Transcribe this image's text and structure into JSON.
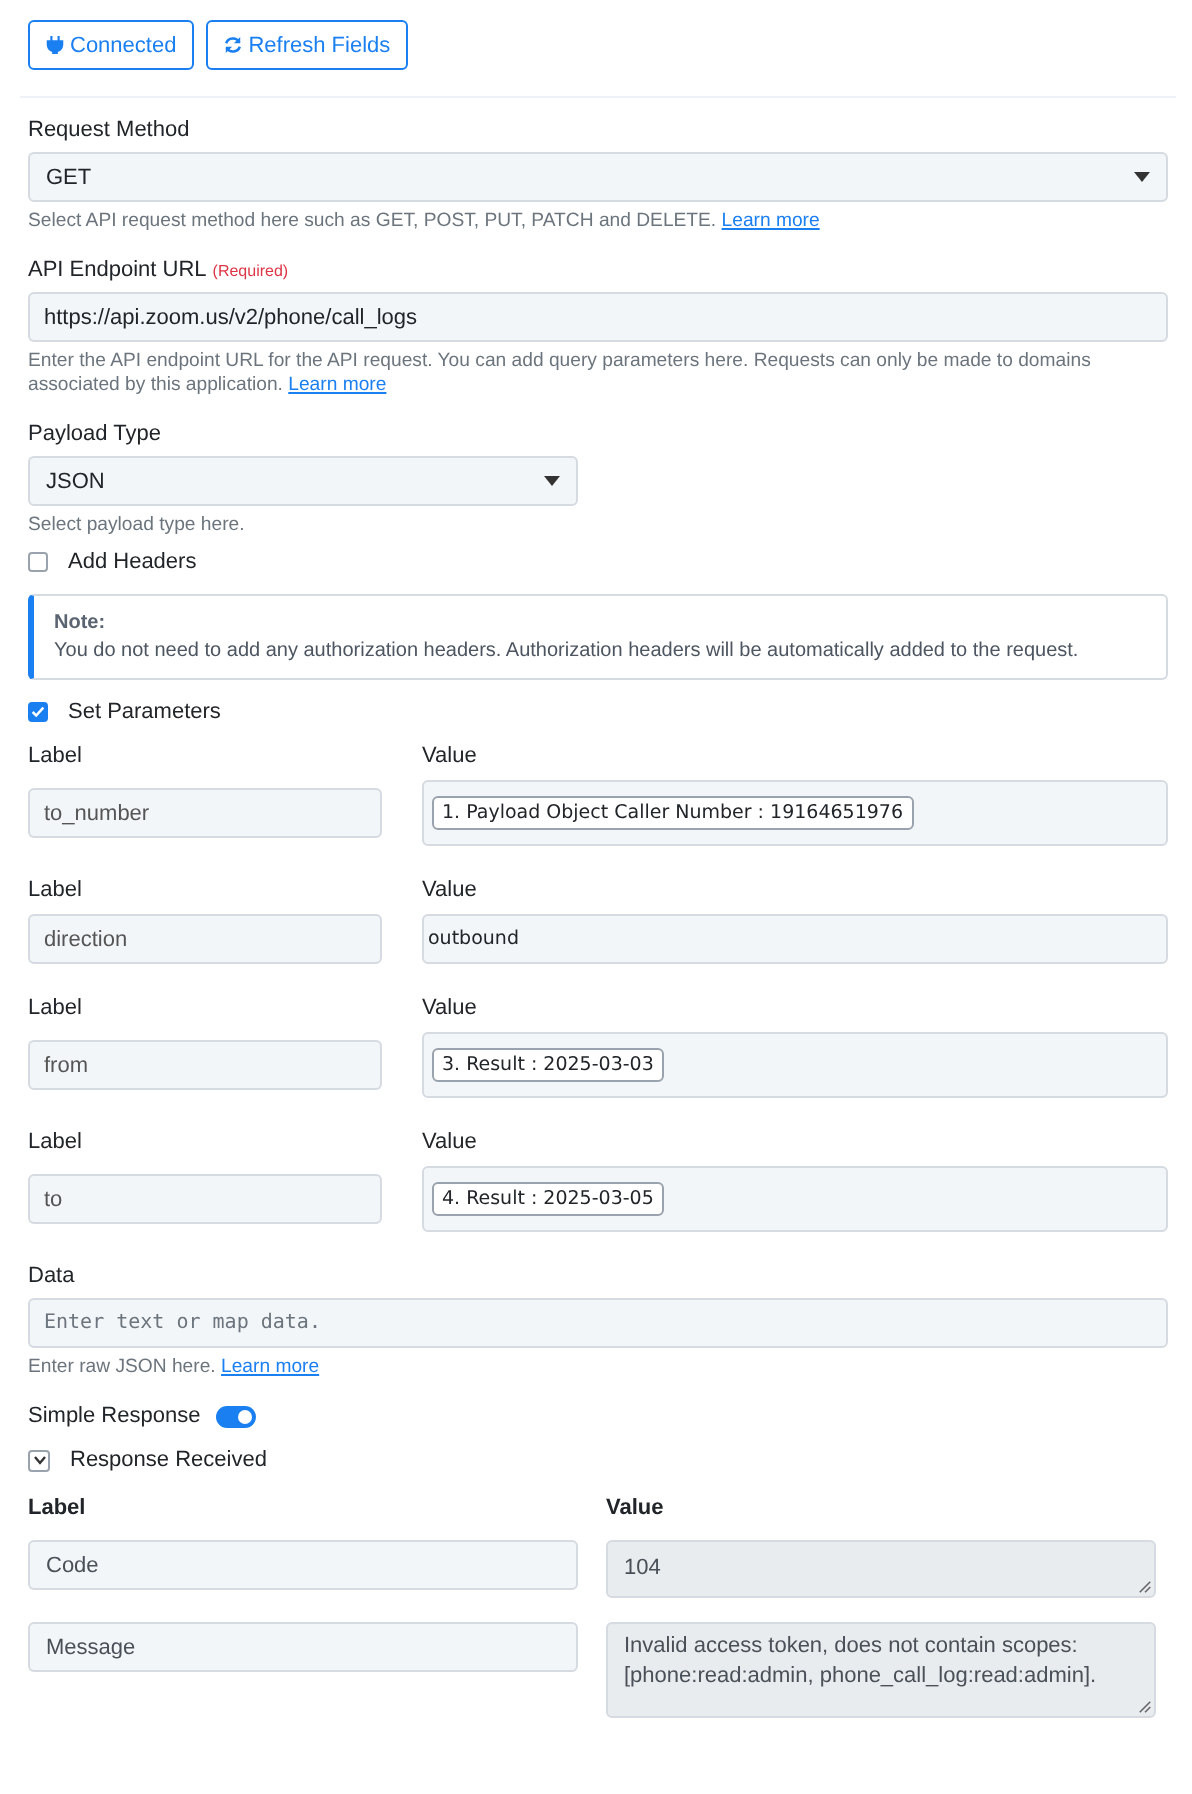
{
  "toolbar": [
    {
      "label": "Connected",
      "kind": "connection"
    },
    {
      "label": "Refresh Fields",
      "kind": "refresh"
    }
  ],
  "request_method": {
    "label": "Request Method",
    "value": "GET",
    "help": "Select API request method here such as GET, POST, PUT, PATCH and DELETE.",
    "help_link": "Learn more"
  },
  "endpoint": {
    "label": "API Endpoint URL",
    "required": "(Required)",
    "value": "https://api.zoom.us/v2/phone/call_logs",
    "help": "Enter the API endpoint URL for the API request. You can add query parameters here. Requests can only be made to domains associated by this application.",
    "help_link": "Learn more"
  },
  "payload_type": {
    "label": "Payload Type",
    "value": "JSON",
    "help": "Select payload type here."
  },
  "add_headers": {
    "label": "Add Headers",
    "checked": false
  },
  "note": {
    "title": "Note:",
    "text": "You do not need to add any authorization headers. Authorization headers will be automatically added to the request."
  },
  "set_parameters": {
    "label": "Set Parameters",
    "checked": true
  },
  "parameters": [
    {
      "label_heading": "Label",
      "value_heading": "Value",
      "name": "to_number",
      "kind": "chip",
      "value": "1. Payload Object Caller Number : 19164651976"
    },
    {
      "label_heading": "Label",
      "value_heading": "Value",
      "name": "direction",
      "kind": "text",
      "value": "outbound"
    },
    {
      "label_heading": "Label",
      "value_heading": "Value",
      "name": "from",
      "kind": "chip",
      "value": "3. Result : 2025-03-03"
    },
    {
      "label_heading": "Label",
      "value_heading": "Value",
      "name": "to",
      "kind": "chip",
      "value": "4. Result : 2025-03-05"
    }
  ],
  "data": {
    "label": "Data",
    "placeholder": "Enter text or map data.",
    "help": "Enter raw JSON here.",
    "help_link": "Learn more"
  },
  "simple_response": {
    "label": "Simple Response",
    "on": true
  },
  "response": {
    "label": "Response Received",
    "expanded": true,
    "columns": [
      "Label",
      "Value"
    ],
    "rows": [
      {
        "label": "Code",
        "value": "104"
      },
      {
        "label": "Message",
        "value": "Invalid access token, does not contain scopes: [phone:read:admin, phone_call_log:read:admin]."
      }
    ]
  }
}
